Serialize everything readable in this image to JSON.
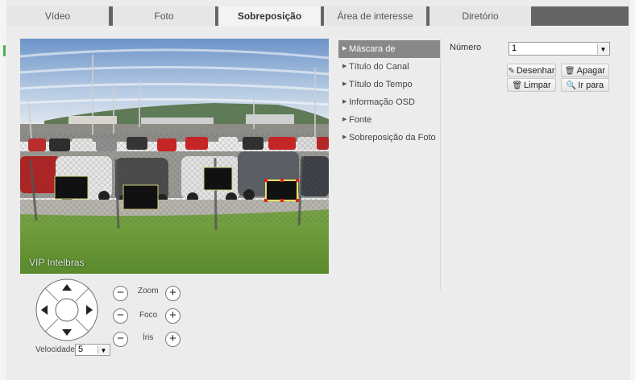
{
  "tabs": [
    {
      "label": "Vídeo",
      "active": false
    },
    {
      "label": "Foto",
      "active": false
    },
    {
      "label": "Sobreposição",
      "active": true
    },
    {
      "label": "Área de interesse",
      "active": false
    },
    {
      "label": "Diretório",
      "active": false
    }
  ],
  "preview": {
    "watermark": "VIP Intelbras"
  },
  "osd_menu": {
    "items": [
      {
        "label": "Máscara de Privacidade",
        "active": true
      },
      {
        "label": "Título do Canal",
        "active": false
      },
      {
        "label": "Título do Tempo",
        "active": false
      },
      {
        "label": "Informação OSD",
        "active": false
      },
      {
        "label": "Fonte",
        "active": false
      },
      {
        "label": "Sobreposição da Foto",
        "active": false
      }
    ]
  },
  "privacy_mask": {
    "numero_label": "Número",
    "numero_value": "1",
    "buttons": {
      "desenhar": "Desenhar",
      "apagar": "Apagar",
      "limpar": "Limpar",
      "ir_para": "Ir para"
    }
  },
  "ptz": {
    "zoom_label": "Zoom",
    "foco_label": "Foco",
    "iris_label": "Íris",
    "minus": "−",
    "plus": "+",
    "velocidade_label": "Velocidade",
    "velocidade_value": "5"
  },
  "icons": {
    "desenhar": "pencil-icon",
    "apagar": "trash-icon",
    "limpar": "trash-icon",
    "ir_para": "search-icon"
  },
  "colors": {
    "tab_bar": "#656565",
    "menu_active": "#888888",
    "mask_selected": "#e8e060",
    "mask_handle": "#e02020"
  }
}
